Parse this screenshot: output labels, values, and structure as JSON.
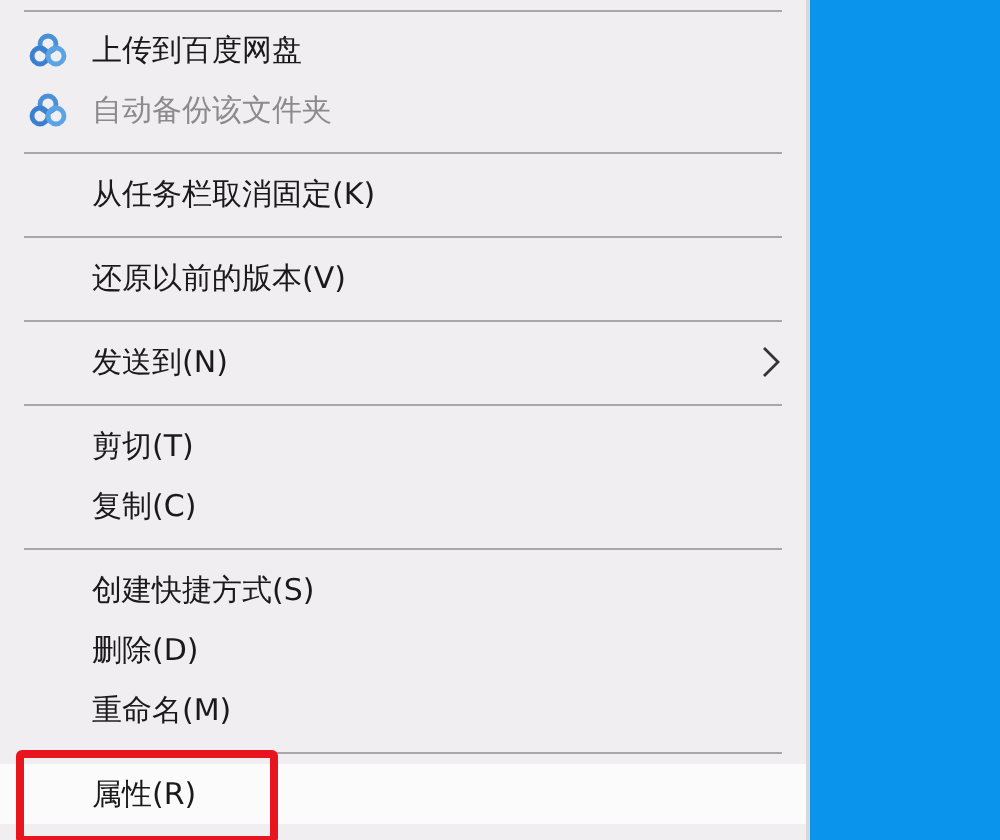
{
  "menu": {
    "items": [
      {
        "kind": "separator"
      },
      {
        "kind": "command",
        "label": "上传到百度网盘",
        "icon": true,
        "disabled": false,
        "submenu": false,
        "highlighted": false
      },
      {
        "kind": "command",
        "label": "自动备份该文件夹",
        "icon": true,
        "disabled": true,
        "submenu": false,
        "highlighted": false
      },
      {
        "kind": "separator"
      },
      {
        "kind": "command",
        "label": "从任务栏取消固定(K)",
        "icon": false,
        "disabled": false,
        "submenu": false,
        "highlighted": false
      },
      {
        "kind": "separator"
      },
      {
        "kind": "command",
        "label": "还原以前的版本(V)",
        "icon": false,
        "disabled": false,
        "submenu": false,
        "highlighted": false
      },
      {
        "kind": "separator"
      },
      {
        "kind": "command",
        "label": "发送到(N)",
        "icon": false,
        "disabled": false,
        "submenu": true,
        "highlighted": false
      },
      {
        "kind": "separator"
      },
      {
        "kind": "command",
        "label": "剪切(T)",
        "icon": false,
        "disabled": false,
        "submenu": false,
        "highlighted": false
      },
      {
        "kind": "command",
        "label": "复制(C)",
        "icon": false,
        "disabled": false,
        "submenu": false,
        "highlighted": false
      },
      {
        "kind": "separator"
      },
      {
        "kind": "command",
        "label": "创建快捷方式(S)",
        "icon": false,
        "disabled": false,
        "submenu": false,
        "highlighted": false
      },
      {
        "kind": "command",
        "label": "删除(D)",
        "icon": false,
        "disabled": false,
        "submenu": false,
        "highlighted": false
      },
      {
        "kind": "command",
        "label": "重命名(M)",
        "icon": false,
        "disabled": false,
        "submenu": false,
        "highlighted": false
      },
      {
        "kind": "separator"
      },
      {
        "kind": "command",
        "label": "属性(R)",
        "icon": false,
        "disabled": false,
        "submenu": false,
        "highlighted": true
      }
    ]
  }
}
